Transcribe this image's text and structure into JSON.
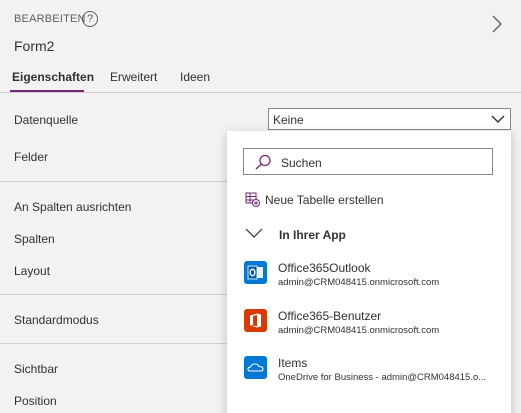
{
  "header": {
    "label": "BEARBEITEN",
    "help_icon": "?",
    "form_name": "Form2"
  },
  "tabs": [
    {
      "label": "Eigenschaften",
      "active": true
    },
    {
      "label": "Erweitert",
      "active": false
    },
    {
      "label": "Ideen",
      "active": false
    }
  ],
  "properties": {
    "datasource_label": "Datenquelle",
    "datasource_value": "Keine",
    "fields_label": "Felder",
    "align_label": "An Spalten ausrichten",
    "columns_label": "Spalten",
    "layout_label": "Layout",
    "default_mode_label": "Standardmodus",
    "visible_label": "Sichtbar",
    "position_label": "Position"
  },
  "flyout": {
    "search_placeholder": "Suchen",
    "new_table_label": "Neue Tabelle erstellen",
    "section_title": "In Ihrer App",
    "items": [
      {
        "title": "Office365Outlook",
        "subtitle": "admin@CRM048415.onmicrosoft.com",
        "icon": "outlook-icon",
        "color": "#0078d4"
      },
      {
        "title": "Office365-Benutzer",
        "subtitle": "admin@CRM048415.onmicrosoft.com",
        "icon": "office-icon",
        "color": "#d83b01"
      },
      {
        "title": "Items",
        "subtitle": "OneDrive for Business - admin@CRM048415.o...",
        "icon": "onedrive-icon",
        "color": "#0078d4"
      }
    ]
  },
  "colors": {
    "accent": "#742774",
    "border": "#8a8886",
    "divider": "#d2d0ce"
  }
}
